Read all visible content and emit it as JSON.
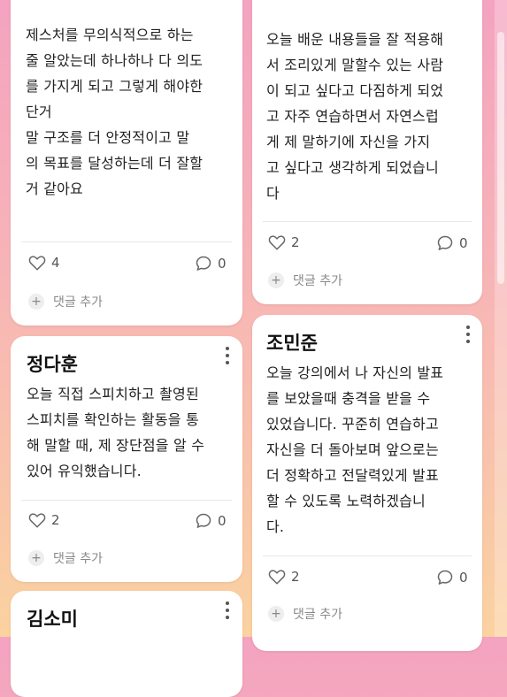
{
  "cards": [
    {
      "author": "",
      "text": "제스처를 무의식적으로 하는\n줄 알았는데 하나하나 다 의도\n를 가지게 되고 그렇게 해야한\n단거\n말 구조를 더 안정적이고 말\n의 목표를 달성하는데 더 잘할\n거 같아요",
      "likes": "4",
      "comments": "0",
      "add_comment": "댓글 추가"
    },
    {
      "author": "",
      "text": "오늘 배운 내용들을 잘 적용해\n서 조리있게 말할수 있는 사람\n이 되고 싶다고 다짐하게 되었\n고 자주 연습하면서 자연스럽\n게 제 말하기에 자신을 가지\n고 싶다고 생각하게 되었습니\n다",
      "likes": "2",
      "comments": "0",
      "add_comment": "댓글 추가"
    },
    {
      "author": "정다훈",
      "text": "오늘 직접 스피치하고 촬영된\n스피치를 확인하는 활동을 통\n해 말할 때, 제 장단점을 알 수\n있어 유익했습니다.",
      "likes": "2",
      "comments": "0",
      "add_comment": "댓글 추가"
    },
    {
      "author": "조민준",
      "text": "오늘 강의에서 나 자신의 발표\n를 보았을때 충격을 받을 수\n있었습니다. 꾸준히 연습하고\n자신을 더 돌아보며 앞으로는\n더 정확하고 전달력있게 발표\n할 수 있도록  노력하겠습니\n다.",
      "likes": "2",
      "comments": "0",
      "add_comment": "댓글 추가"
    },
    {
      "author": "김소미"
    }
  ],
  "icons": {
    "like": "heart-outline-icon",
    "comment": "speech-bubble-icon",
    "add": "plus-icon",
    "menu": "vertical-dots-icon"
  },
  "colors": {
    "background_top": "#f4a3c0",
    "background_bottom": "#fbd2a0",
    "card": "#ffffff"
  }
}
